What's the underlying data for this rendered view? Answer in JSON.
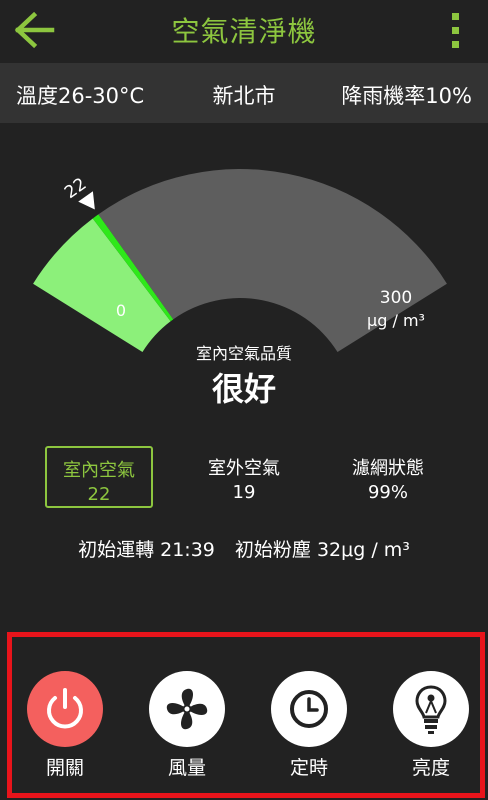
{
  "header": {
    "title": "空氣清淨機"
  },
  "weather": {
    "temp": "溫度26-30°C",
    "city": "新北市",
    "rain": "降雨機率10%"
  },
  "gauge": {
    "min_label": "0",
    "max_label": "300",
    "unit": "μg / m³",
    "current": "22",
    "value": 22,
    "max": 300,
    "colors": {
      "light_green": "#8cf07a",
      "green": "#2ee81a",
      "gray": "#5e5e5e"
    }
  },
  "quality": {
    "label": "室內空氣品質",
    "value": "很好"
  },
  "tabs": [
    {
      "label": "室內空氣",
      "value": "22"
    },
    {
      "label": "室外空氣",
      "value": "19"
    },
    {
      "label": "濾網狀態",
      "value": "99%"
    }
  ],
  "stats": {
    "runtime": "初始運轉 21:39",
    "dust": "初始粉塵 32μg / m³"
  },
  "controls": [
    {
      "label": "開關",
      "icon": "power-icon"
    },
    {
      "label": "風量",
      "icon": "fan-icon"
    },
    {
      "label": "定時",
      "icon": "clock-icon"
    },
    {
      "label": "亮度",
      "icon": "bulb-icon"
    }
  ],
  "colors": {
    "accent": "#8dc63f",
    "highlight_border": "#e8141b",
    "power": "#f4605e"
  }
}
